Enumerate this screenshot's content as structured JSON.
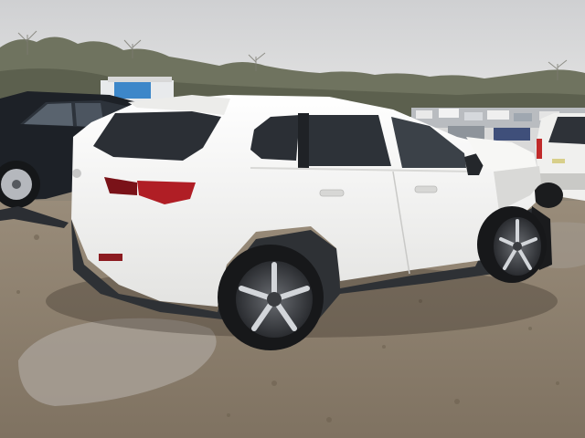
{
  "scene": {
    "subject": "white-compact-suv-damaged-front",
    "setting": "muddy-salvage-auction-lot",
    "colors": {
      "sky": "#d6d7d8",
      "trees": "#6f735f",
      "mud": "#8a7c6a",
      "puddle": "#a69e94",
      "suv_body": "#f3f3f1",
      "cladding": "#2e3135",
      "glass": "#2b2f35",
      "taillight": "#b01e25",
      "black_sedan": "#1d2127",
      "white_pickup": "#f0f0ee"
    }
  }
}
